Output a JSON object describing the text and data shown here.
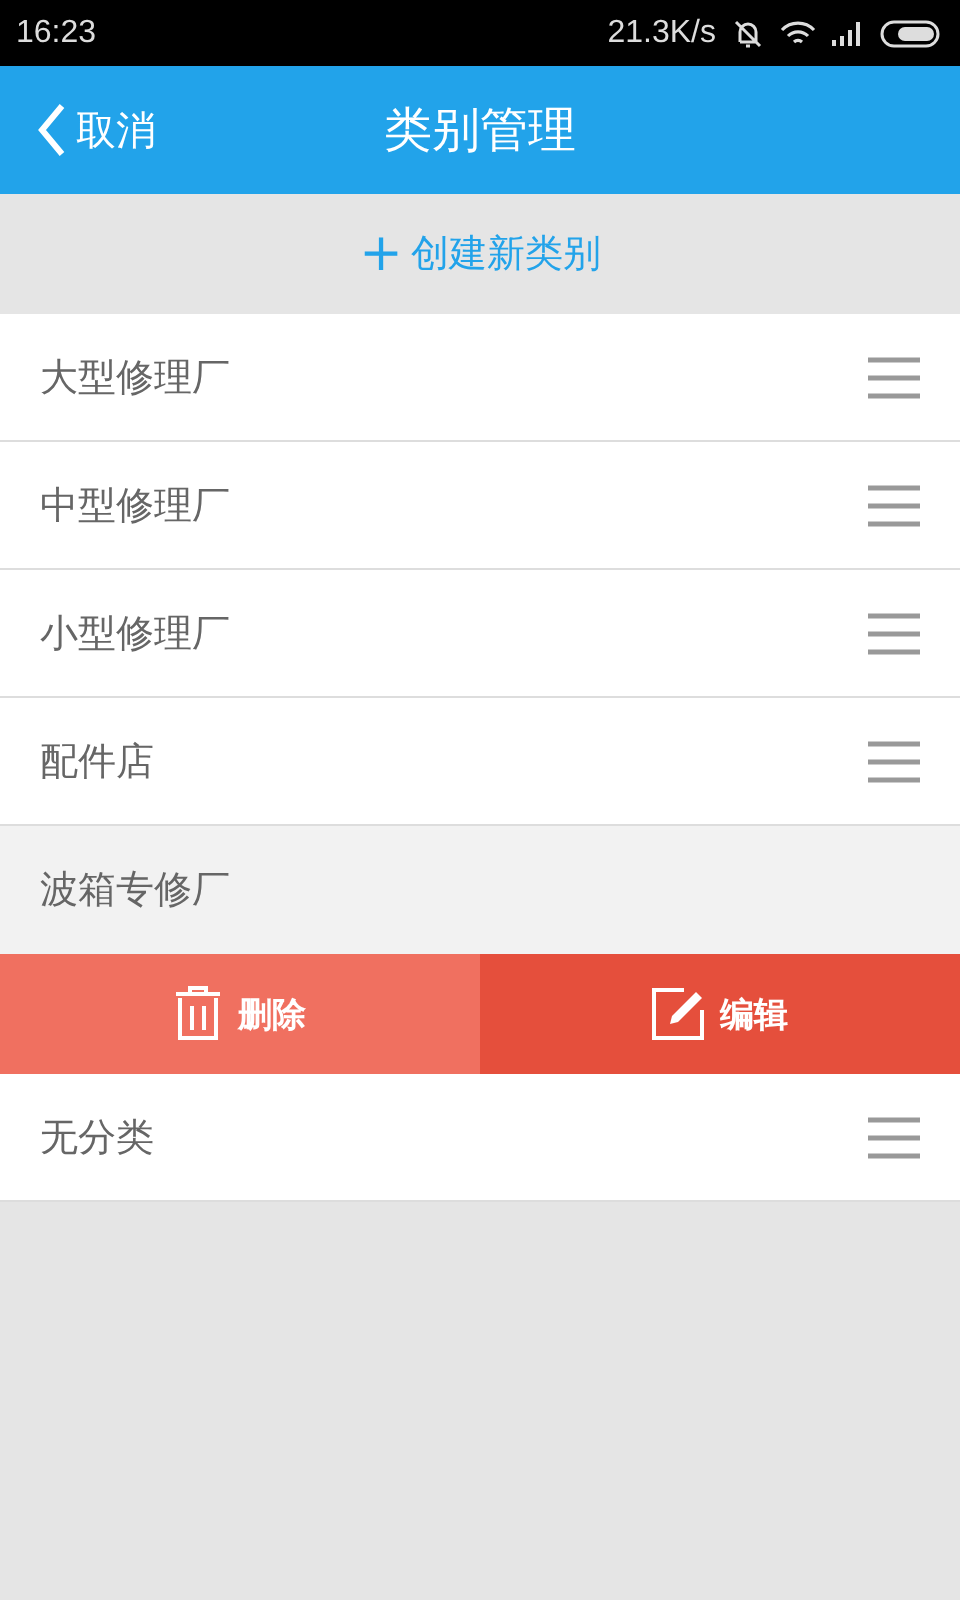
{
  "status_bar": {
    "time": "16:23",
    "speed": "21.3K/s"
  },
  "header": {
    "back": "取消",
    "title": "类别管理"
  },
  "create": {
    "icon": "+",
    "label": "创建新类别"
  },
  "categories": [
    {
      "name": "大型修理厂",
      "expanded": false
    },
    {
      "name": "中型修理厂",
      "expanded": false
    },
    {
      "name": "小型修理厂",
      "expanded": false
    },
    {
      "name": "配件店",
      "expanded": false
    },
    {
      "name": "波箱专修厂",
      "expanded": true,
      "actions": [
        {
          "kind": "delete",
          "label": "删除"
        },
        {
          "kind": "edit",
          "label": "编辑"
        }
      ]
    },
    {
      "name": "无分类",
      "expanded": false
    }
  ]
}
